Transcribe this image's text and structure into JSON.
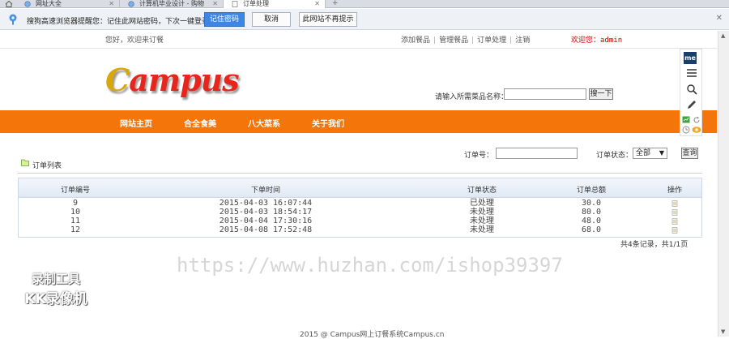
{
  "tabs": [
    {
      "label": "网址大全"
    },
    {
      "label": "计算机毕业设计 - 购物"
    },
    {
      "label": "订单处理"
    }
  ],
  "notify": {
    "message": "搜狗高速浏览器提醒您：记住此网站密码，下次一键登录！",
    "remember": "记住密码",
    "cancel": "取消",
    "never": "此网站不再提示"
  },
  "header": {
    "welcome": "您好，欢迎来订餐",
    "links": [
      "添加餐品",
      "管理餐品",
      "订单处理",
      "注销"
    ],
    "user_label": "欢迎您：",
    "user_name": "admin",
    "logo": "Campus",
    "search_label": "请输入所需菜品名称：",
    "search_value": "",
    "search_button": "搜一下"
  },
  "nav": [
    "网站主页",
    "合全食美",
    "八大菜系",
    "关于我们"
  ],
  "filter": {
    "order_no_label": "订单号：",
    "order_no_value": "",
    "status_label": "订单状态：",
    "status_value": "全部",
    "query_button": "查询"
  },
  "list": {
    "title": "订单列表",
    "columns": [
      "订单编号",
      "下单时间",
      "订单状态",
      "订单总额",
      "操作"
    ],
    "rows": [
      {
        "id": "9",
        "time": "2015-04-03 16:07:44",
        "status": "已处理",
        "total": "30.0"
      },
      {
        "id": "10",
        "time": "2015-04-03 18:54:17",
        "status": "未处理",
        "total": "80.0"
      },
      {
        "id": "11",
        "time": "2015-04-04 17:30:16",
        "status": "未处理",
        "total": "48.0"
      },
      {
        "id": "12",
        "time": "2015-04-08 17:52:48",
        "status": "未处理",
        "total": "68.0"
      }
    ],
    "pager": "共4条记录，共1/1页"
  },
  "watermark": "https://www.huzhan.com/ishop39397",
  "recorder": {
    "line1": "录制工具",
    "line2": "KK录像机"
  },
  "sidetool": {
    "badge": "me"
  },
  "footer": "2015 @ Campus网上订餐系统Campus.cn",
  "colors": {
    "nav_bg": "#f4760a",
    "logo_red": "#e8251b",
    "notify_btn": "#3e86e6",
    "user_red": "#cc0000"
  }
}
